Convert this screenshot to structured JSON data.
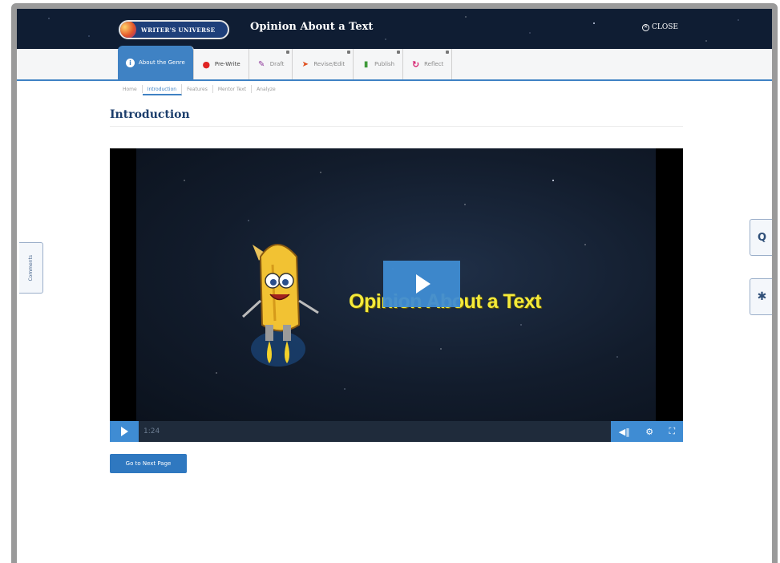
{
  "header": {
    "logo_text": "WRITER'S UNIVERSE",
    "title": "Opinion About a Text",
    "close_label": "CLOSE"
  },
  "steps": [
    {
      "label": "About the Genre",
      "icon": "info-icon",
      "active": true
    },
    {
      "label": "Pre-Write",
      "icon": "pin-icon"
    },
    {
      "label": "Draft",
      "icon": "pencil-icon"
    },
    {
      "label": "Revise/Edit",
      "icon": "cursor-icon"
    },
    {
      "label": "Publish",
      "icon": "document-icon"
    },
    {
      "label": "Reflect",
      "icon": "reflect-icon"
    }
  ],
  "subtabs": [
    "Home",
    "Introduction",
    "Features",
    "Mentor Text",
    "Analyze"
  ],
  "active_subtab": "Introduction",
  "page_title": "Introduction",
  "video": {
    "title": "Opinion About a Text",
    "time": "1:24"
  },
  "next_button": "Go to Next Page",
  "left_tab": "Comments",
  "colors": {
    "accent": "#3f82c4",
    "header_bg": "#0f1d33",
    "title_color": "#1c3e6c",
    "video_title": "#f4ea3a"
  }
}
